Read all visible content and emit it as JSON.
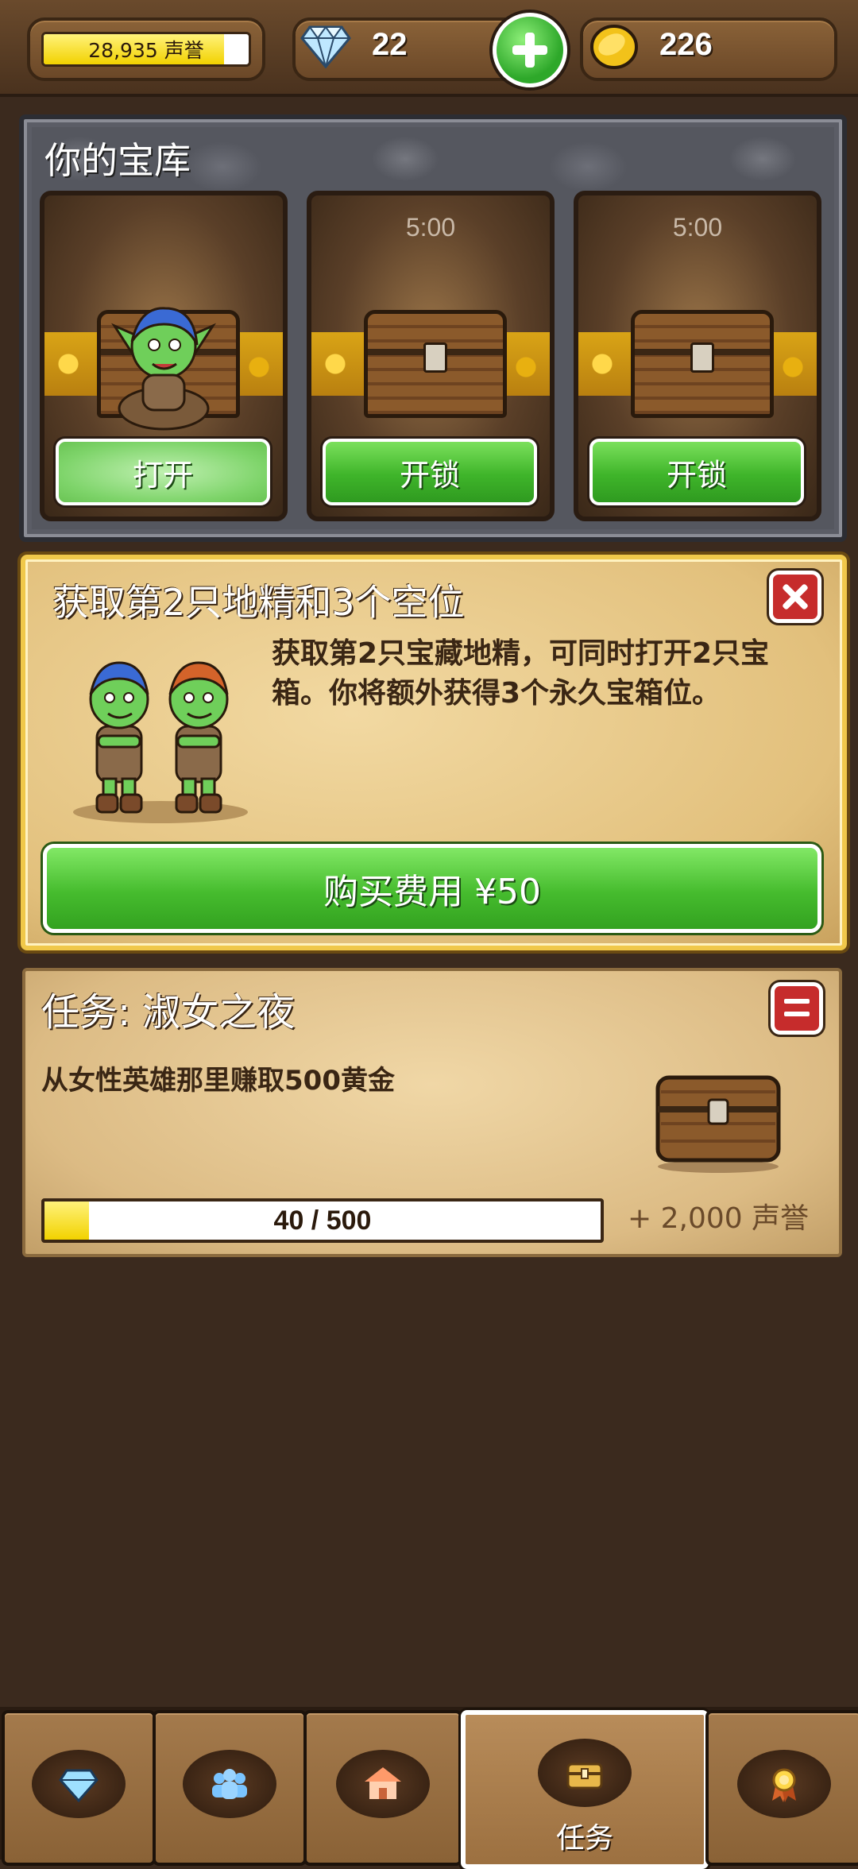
{
  "status": {
    "reputation": "28,935 声誉",
    "reputation_progress": 0.88,
    "gems": "22",
    "gold": "226"
  },
  "vault": {
    "title": "你的宝库",
    "slots": [
      {
        "timer": "",
        "button": "打开"
      },
      {
        "timer": "5:00",
        "button": "开锁"
      },
      {
        "timer": "5:00",
        "button": "开锁"
      }
    ]
  },
  "offer": {
    "title": "获取第2只地精和3个空位",
    "description": "获取第2只宝藏地精，可同时打开2只宝箱。你将额外获得3个永久宝箱位。",
    "buy_label": "购买费用 ¥50"
  },
  "quest": {
    "title": "任务: 淑女之夜",
    "description": "从女性英雄那里赚取500黄金",
    "progress_text": "40 / 500",
    "progress": 0.08,
    "reward": "+ 2,000 声誉"
  },
  "nav": {
    "tabs": [
      {
        "icon": "diamond-icon",
        "label": ""
      },
      {
        "icon": "heroes-icon",
        "label": ""
      },
      {
        "icon": "buildings-icon",
        "label": ""
      },
      {
        "icon": "chest-icon",
        "label": "任务"
      },
      {
        "icon": "medal-icon",
        "label": ""
      }
    ],
    "active_index": 3
  },
  "colors": {
    "background": "#3b2a1e",
    "accent_green": "#46bc2e",
    "gold": "#f2d200",
    "close_red": "#c62c2c"
  }
}
